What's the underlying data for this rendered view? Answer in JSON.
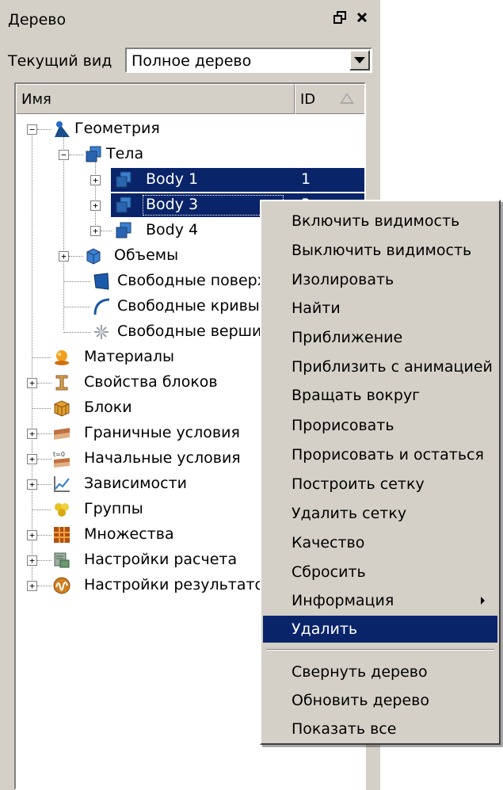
{
  "panel": {
    "title": "Дерево",
    "view_label": "Текущий вид",
    "view_value": "Полное дерево"
  },
  "tree": {
    "columns": [
      {
        "label": "Имя"
      },
      {
        "label": "ID"
      }
    ],
    "rows": [
      {
        "label": "Геометрия",
        "id": "",
        "icon": "geometry-icon"
      },
      {
        "label": "Тела",
        "id": "",
        "icon": "bodies-icon"
      },
      {
        "label": "Body 1",
        "id": "1",
        "icon": "body-icon",
        "selected": true
      },
      {
        "label": "Body 3",
        "id": "3",
        "icon": "body-icon",
        "selected": true
      },
      {
        "label": "Body 4",
        "id": "",
        "icon": "body-icon"
      },
      {
        "label": "Объемы",
        "id": "",
        "icon": "volume-icon"
      },
      {
        "label": "Свободные поверх",
        "id": "",
        "icon": "surface-icon"
      },
      {
        "label": "Свободные кривы",
        "id": "",
        "icon": "curve-icon"
      },
      {
        "label": "Свободные верши",
        "id": "",
        "icon": "vertex-icon"
      },
      {
        "label": "Материалы",
        "id": "",
        "icon": "materials-icon"
      },
      {
        "label": "Свойства блоков",
        "id": "",
        "icon": "block-properties-icon"
      },
      {
        "label": "Блоки",
        "id": "",
        "icon": "blocks-icon"
      },
      {
        "label": "Граничные условия",
        "id": "",
        "icon": "boundary-conditions-icon"
      },
      {
        "label": "Начальные условия",
        "id": "",
        "icon": "initial-conditions-icon"
      },
      {
        "label": "Зависимости",
        "id": "",
        "icon": "dependencies-icon"
      },
      {
        "label": "Группы",
        "id": "",
        "icon": "groups-icon"
      },
      {
        "label": "Множества",
        "id": "",
        "icon": "sets-icon"
      },
      {
        "label": "Настройки расчета",
        "id": "",
        "icon": "calc-settings-icon"
      },
      {
        "label": "Настройки результатов",
        "id": "",
        "icon": "result-settings-icon"
      }
    ]
  },
  "context_menu": {
    "items": [
      {
        "label": "Включить видимость"
      },
      {
        "label": "Выключить видимость"
      },
      {
        "label": "Изолировать"
      },
      {
        "label": "Найти"
      },
      {
        "label": "Приближение"
      },
      {
        "label": "Приблизить с анимацией"
      },
      {
        "label": "Вращать вокруг"
      },
      {
        "label": "Прорисовать"
      },
      {
        "label": "Прорисовать и остаться"
      },
      {
        "label": "Построить сетку"
      },
      {
        "label": "Удалить сетку"
      },
      {
        "label": "Качество"
      },
      {
        "label": "Сбросить"
      },
      {
        "label": "Информация"
      },
      {
        "label": "Удалить"
      },
      {
        "label": "Свернуть дерево"
      },
      {
        "label": "Обновить дерево"
      },
      {
        "label": "Показать все"
      }
    ],
    "active_item": "Удалить"
  },
  "colors": {
    "selection": "#0a246a",
    "face": "#d4d0c8"
  }
}
